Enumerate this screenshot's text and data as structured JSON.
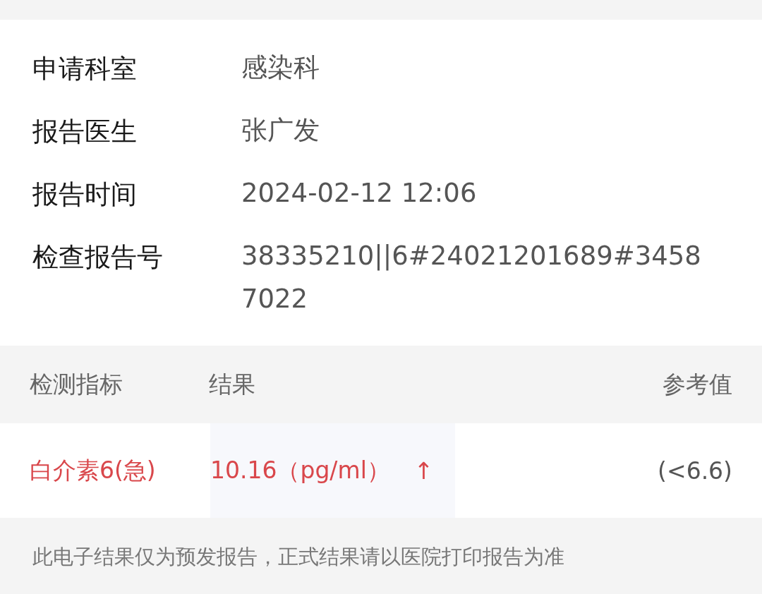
{
  "info": [
    {
      "label": "申请科室",
      "value": "感染科"
    },
    {
      "label": "报告医生",
      "value": "张广发"
    },
    {
      "label": "报告时间",
      "value": "2024-02-12 12:06"
    },
    {
      "label": "检查报告号",
      "value": "38335210||6#24021201689#34587022"
    }
  ],
  "table": {
    "columns": [
      "检测指标",
      "结果",
      "参考值"
    ],
    "rows": [
      {
        "name": "白介素6(急)",
        "result": "10.16（pg/ml）",
        "flag": "↑",
        "reference": "(<6.6)",
        "abnormal": true
      }
    ]
  },
  "footer": "此电子结果仅为预发报告，正式结果请以医院打印报告为准"
}
